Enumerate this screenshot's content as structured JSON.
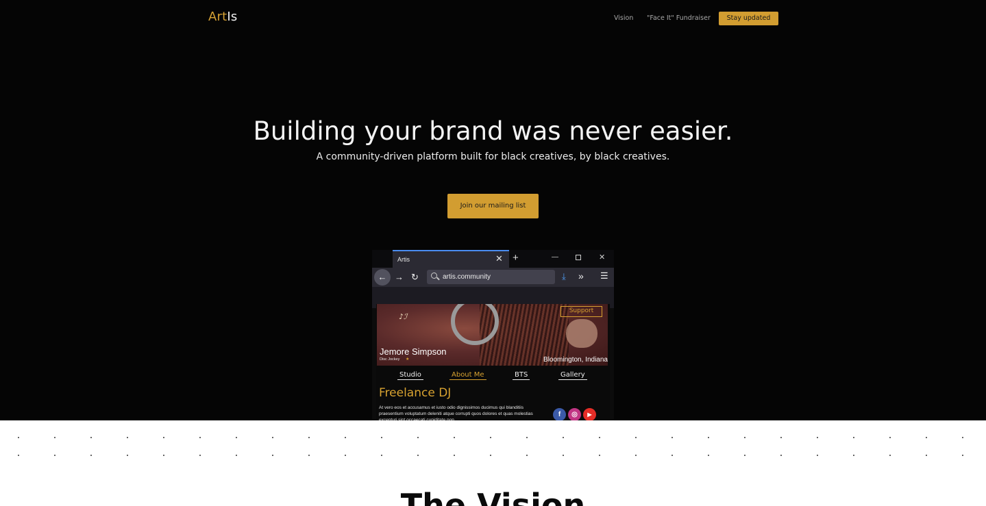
{
  "nav": {
    "logo_part1": "Art",
    "logo_part2": "Is",
    "links": [
      "Vision",
      "\"Face It\" Fundraiser"
    ],
    "cta": "Stay updated"
  },
  "hero": {
    "headline": "Building your brand was never easier.",
    "subheadline": "A community-driven platform built for black creatives, by black creatives.",
    "cta": "Join our mailing list"
  },
  "mockup": {
    "browser": {
      "tab_title": "Artis",
      "url": "artis.community"
    },
    "profile": {
      "support_label": "Support",
      "name": "Jemore Simpson",
      "role": "Disc Jockey",
      "location": "Bloomington, Indiana",
      "nav": [
        "Studio",
        "About Me",
        "BTS",
        "Gallery"
      ],
      "title": "Freelance DJ",
      "body": "At vero eos et accusamus et iusto odio dignissimos ducimus qui blanditiis praesentium voluptatum deleniti atque corrupti quos dolores et quas molestias excepturi sint occaecati cupiditate non"
    }
  },
  "vision_section": {
    "heading": "The Vision"
  },
  "colors": {
    "accent": "#d29d31",
    "hero_bg": "#050505",
    "page_bg": "#ffffff"
  }
}
